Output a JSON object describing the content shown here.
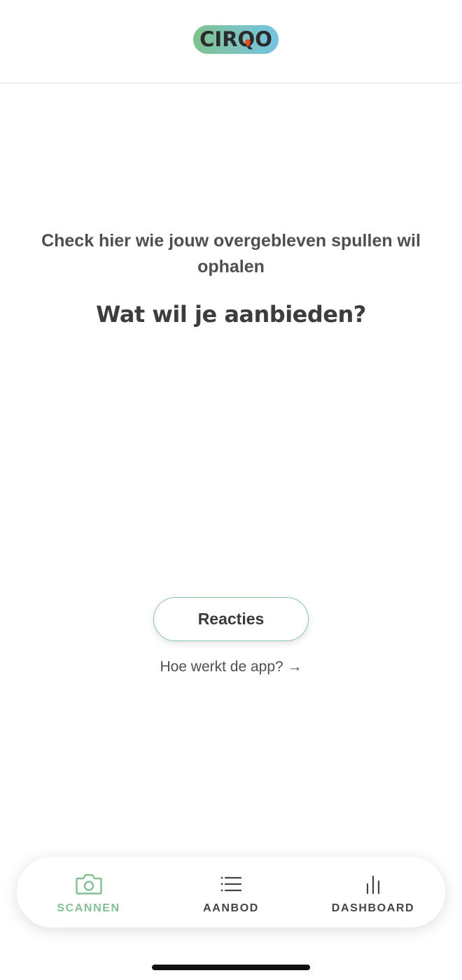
{
  "brand": {
    "logo_text": "CIRQO",
    "accent_green": "#7fc28d",
    "accent_blue": "#74c3e3",
    "pin_color": "#e84b22"
  },
  "main": {
    "subtitle": "Check hier wie jouw overgebleven spullen wil ophalen",
    "question": "Wat wil je aanbieden?",
    "reacties_button_label": "Reacties",
    "help_link_text": "Hoe werkt de app? →"
  },
  "bottom_nav": {
    "active_color": "#83bf93",
    "inactive_color": "#444448",
    "items": [
      {
        "label": "SCANNEN",
        "icon": "camera-icon",
        "active": true
      },
      {
        "label": "AANBOD",
        "icon": "list-icon",
        "active": false
      },
      {
        "label": "DASHBOARD",
        "icon": "bar-chart-icon",
        "active": false
      }
    ]
  }
}
